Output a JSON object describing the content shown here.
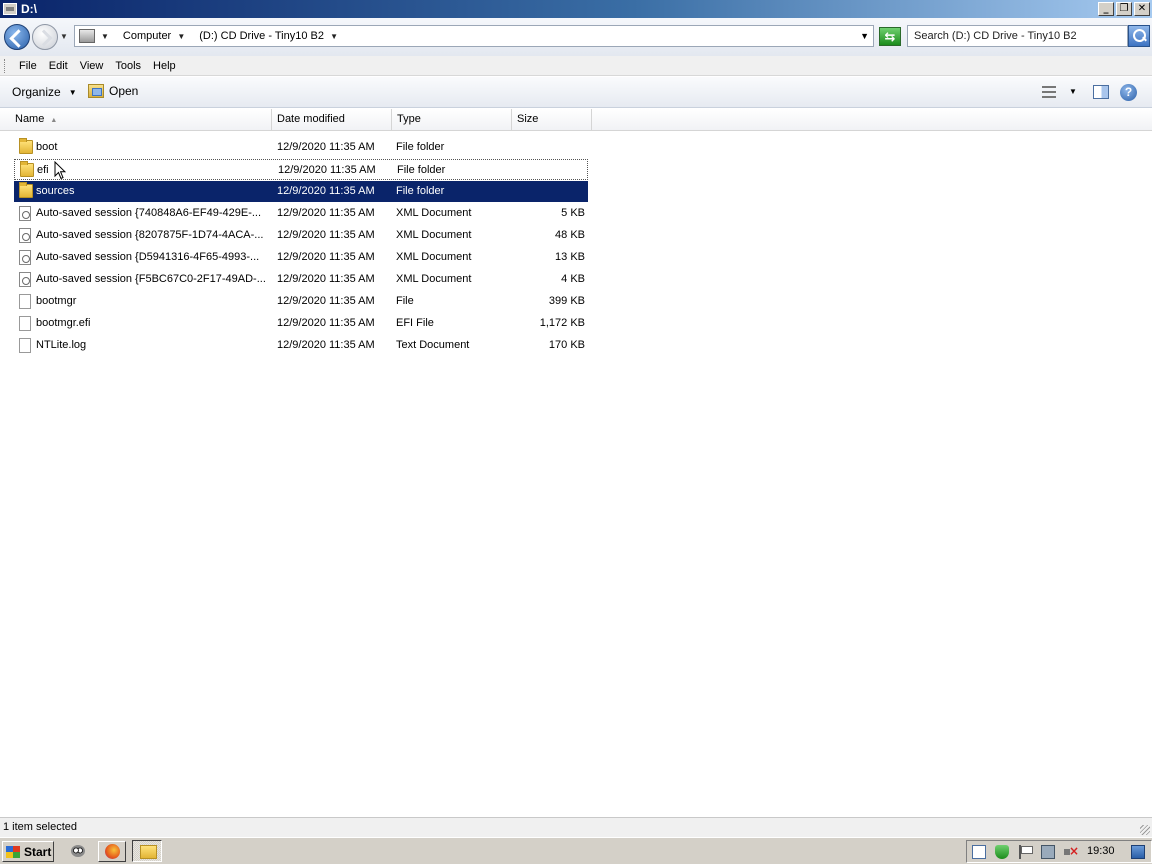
{
  "window": {
    "title": "D:\\"
  },
  "address": {
    "crumbs": [
      "Computer",
      "(D:) CD Drive - Tiny10 B2"
    ],
    "search_placeholder": "Search (D:) CD Drive - Tiny10 B2"
  },
  "menu": {
    "file": "File",
    "edit": "Edit",
    "view": "View",
    "tools": "Tools",
    "help": "Help"
  },
  "commands": {
    "organize": "Organize",
    "open": "Open"
  },
  "columns": {
    "name": "Name",
    "date": "Date modified",
    "type": "Type",
    "size": "Size"
  },
  "files": [
    {
      "name": "boot",
      "date": "12/9/2020 11:35 AM",
      "type": "File folder",
      "size": "",
      "icon": "folder-icon",
      "state": "normal"
    },
    {
      "name": "efi",
      "date": "12/9/2020 11:35 AM",
      "type": "File folder",
      "size": "",
      "icon": "folder-icon",
      "state": "focused"
    },
    {
      "name": "sources",
      "date": "12/9/2020 11:35 AM",
      "type": "File folder",
      "size": "",
      "icon": "folder-icon",
      "state": "selected"
    },
    {
      "name": "Auto-saved session {740848A6-EF49-429E-...",
      "date": "12/9/2020 11:35 AM",
      "type": "XML Document",
      "size": "5 KB",
      "icon": "xml-icon",
      "state": "normal"
    },
    {
      "name": "Auto-saved session {8207875F-1D74-4ACA-...",
      "date": "12/9/2020 11:35 AM",
      "type": "XML Document",
      "size": "48 KB",
      "icon": "xml-icon",
      "state": "normal"
    },
    {
      "name": "Auto-saved session {D5941316-4F65-4993-...",
      "date": "12/9/2020 11:35 AM",
      "type": "XML Document",
      "size": "13 KB",
      "icon": "xml-icon",
      "state": "normal"
    },
    {
      "name": "Auto-saved session {F5BC67C0-2F17-49AD-...",
      "date": "12/9/2020 11:35 AM",
      "type": "XML Document",
      "size": "4 KB",
      "icon": "xml-icon",
      "state": "normal"
    },
    {
      "name": "bootmgr",
      "date": "12/9/2020 11:35 AM",
      "type": "File",
      "size": "399 KB",
      "icon": "file-icon",
      "state": "normal"
    },
    {
      "name": "bootmgr.efi",
      "date": "12/9/2020 11:35 AM",
      "type": "EFI File",
      "size": "1,172 KB",
      "icon": "file-icon",
      "state": "normal"
    },
    {
      "name": "NTLite.log",
      "date": "12/9/2020 11:35 AM",
      "type": "Text Document",
      "size": "170 KB",
      "icon": "file-icon",
      "state": "normal"
    }
  ],
  "status": {
    "text": "1 item selected"
  },
  "taskbar": {
    "start": "Start",
    "clock": "19:30"
  },
  "colors": {
    "selection": "#0a246a",
    "titlebar_start": "#0a246a",
    "titlebar_end": "#a6caf0"
  }
}
